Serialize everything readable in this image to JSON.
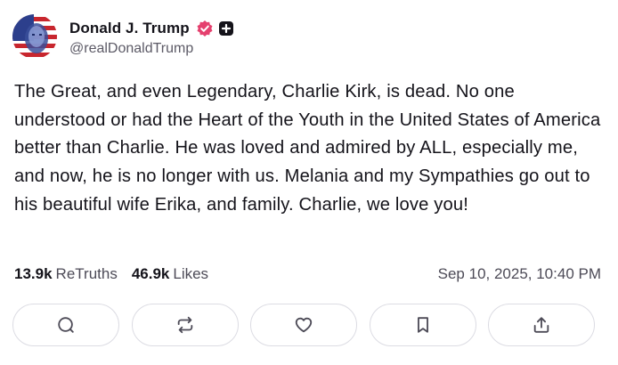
{
  "profile": {
    "display_name": "Donald J. Trump",
    "handle": "@realDonaldTrump",
    "verified_badge_icon": "verified-badge-icon",
    "plus_icon": "plus-square-icon",
    "badge_color": "#e5406e"
  },
  "post": {
    "text": "The Great, and even Legendary, Charlie Kirk, is dead. No one understood or had the Heart of the Youth in the United States of America better than Charlie. He was loved and admired by ALL, especially me, and now, he is no longer with us. Melania and my Sympathies go out to his beautiful wife Erika, and family. Charlie, we love you!"
  },
  "stats": {
    "retruths_count": "13.9k",
    "retruths_label": "ReTruths",
    "likes_count": "46.9k",
    "likes_label": "Likes",
    "timestamp": "Sep 10, 2025, 10:40 PM"
  },
  "actions": [
    {
      "icon": "reply-icon"
    },
    {
      "icon": "retruth-icon"
    },
    {
      "icon": "like-heart-icon"
    },
    {
      "icon": "bookmark-icon"
    },
    {
      "icon": "share-icon"
    }
  ]
}
